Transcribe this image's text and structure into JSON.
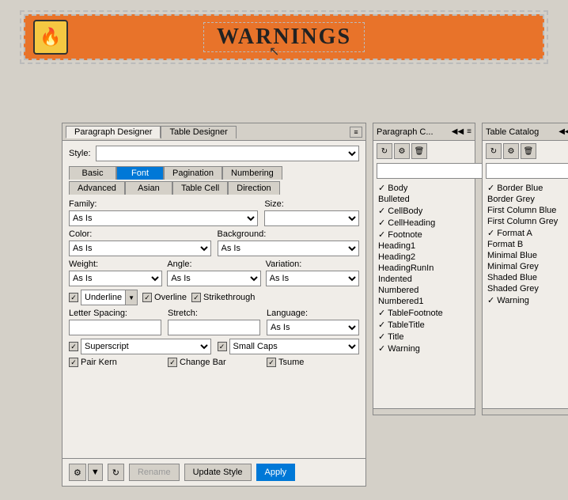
{
  "topArea": {
    "warningText": "WARNINGS"
  },
  "paragraphDesigner": {
    "title": "Paragraph Designer",
    "menuBtn": "≡",
    "tabs": [
      "Table Designer"
    ],
    "activeTab": "Paragraph Designer",
    "innerTabs1": [
      "Basic",
      "Font",
      "Pagination",
      "Numbering"
    ],
    "innerTabs2": [
      "Advanced",
      "Asian",
      "Table Cell",
      "Direction"
    ],
    "activeInnerTab": "Font",
    "styleLabel": "Style:",
    "familyLabel": "Family:",
    "sizeLabel": "Size:",
    "colorLabel": "Color:",
    "backgroundLabel": "Background:",
    "weightLabel": "Weight:",
    "angleLabel": "Angle:",
    "variationLabel": "Variation:",
    "familyValue": "As Is",
    "sizeValue": "",
    "colorValue": "As Is",
    "backgroundValue": "As Is",
    "weightValue": "As Is",
    "angleValue": "As Is",
    "variationValue": "As Is",
    "underlineLabel": "Underline",
    "overlineLabel": "Overline",
    "strikethroughLabel": "Strikethrough",
    "letterSpacingLabel": "Letter Spacing:",
    "stretchLabel": "Stretch:",
    "languageLabel": "Language:",
    "languageValue": "As Is",
    "superscriptLabel": "Superscript",
    "smallCapsLabel": "Small Caps",
    "pairKernLabel": "Pair Kern",
    "changeBarLabel": "Change Bar",
    "tsumeLabel": "Tsume",
    "renameBtn": "Rename",
    "updateStyleBtn": "Update Style",
    "applyBtn": "Apply"
  },
  "paragraphCatalog": {
    "title": "Paragraph C...",
    "items": [
      {
        "label": "✓ Body",
        "checked": true
      },
      {
        "label": "  Bulleted",
        "checked": false
      },
      {
        "label": "✓ CellBody",
        "checked": true
      },
      {
        "label": "✓ CellHeading",
        "checked": true
      },
      {
        "label": "✓ Footnote",
        "checked": true
      },
      {
        "label": "  Heading1",
        "checked": false
      },
      {
        "label": "  Heading2",
        "checked": false
      },
      {
        "label": "  HeadingRunIn",
        "checked": false
      },
      {
        "label": "  Indented",
        "checked": false
      },
      {
        "label": "  Numbered",
        "checked": false
      },
      {
        "label": "  Numbered1",
        "checked": false
      },
      {
        "label": "✓ TableFootnote",
        "checked": true
      },
      {
        "label": "✓ TableTitle",
        "checked": true
      },
      {
        "label": "✓ Title",
        "checked": true
      },
      {
        "label": "✓ Warning",
        "checked": true
      }
    ]
  },
  "tableCatalog": {
    "title": "Table Catalog",
    "items": [
      {
        "label": "✓ Border Blue",
        "checked": true
      },
      {
        "label": "  Border Grey",
        "checked": false
      },
      {
        "label": "  First Column Blue",
        "checked": false
      },
      {
        "label": "  First Column Grey",
        "checked": false
      },
      {
        "label": "✓ Format A",
        "checked": true
      },
      {
        "label": "  Format B",
        "checked": false
      },
      {
        "label": "  Minimal Blue",
        "checked": false
      },
      {
        "label": "  Minimal Grey",
        "checked": false
      },
      {
        "label": "  Shaded Blue",
        "checked": false
      },
      {
        "label": "  Shaded Grey",
        "checked": false
      },
      {
        "label": "✓ Warning",
        "checked": true
      }
    ]
  }
}
